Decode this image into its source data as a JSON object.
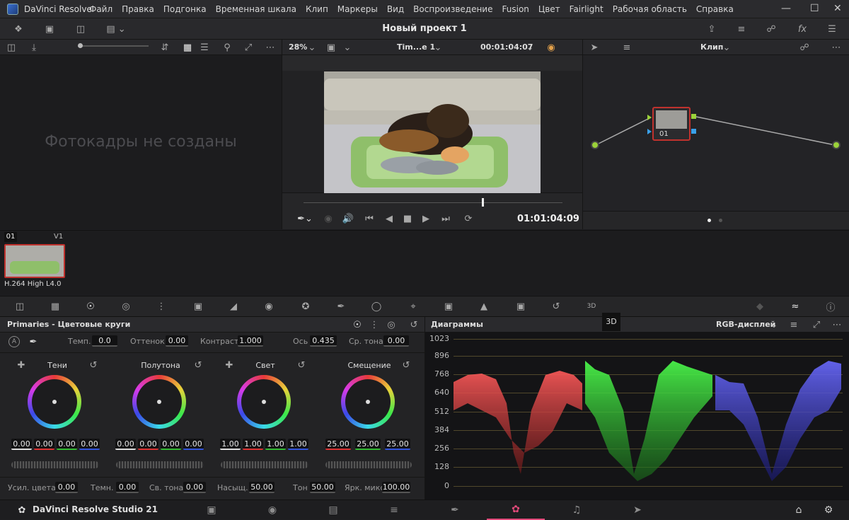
{
  "titlebar": {
    "app": "DaVinci Resolve",
    "menu": [
      "Файл",
      "Правка",
      "Подгонка",
      "Временная шкала",
      "Клип",
      "Маркеры",
      "Вид",
      "Воспроизведение",
      "Fusion",
      "Цвет",
      "Fairlight",
      "Рабочая область",
      "Справка"
    ]
  },
  "toolbar": {
    "project_title": "Новый проект 1"
  },
  "viewer": {
    "zoom": "28%",
    "timeline_name": "Tim...e 1",
    "timecode_top": "00:01:04:07",
    "timecode": "01:01:04:09"
  },
  "nodes": {
    "mode": "Клип",
    "node_label": "01"
  },
  "gallery": {
    "empty_text": "Фотокадры не созданы"
  },
  "clips": {
    "clip_number": "01",
    "track": "V1",
    "codec": "H.264 High L4.0"
  },
  "primaries": {
    "title": "Primaries - Цветовые круги",
    "temp_label": "Темп.",
    "temp": "0.0",
    "tint_label": "Оттенок",
    "tint": "0.00",
    "contrast_label": "Контраст",
    "contrast": "1.000",
    "pivot_label": "Ось",
    "pivot": "0.435",
    "midtone_label": "Ср. тона",
    "midtone": "0.00",
    "wheels": [
      {
        "name": "Тени",
        "vals": [
          "0.00",
          "0.00",
          "0.00",
          "0.00"
        ]
      },
      {
        "name": "Полутона",
        "vals": [
          "0.00",
          "0.00",
          "0.00",
          "0.00"
        ]
      },
      {
        "name": "Свет",
        "vals": [
          "1.00",
          "1.00",
          "1.00",
          "1.00"
        ]
      },
      {
        "name": "Смещение",
        "vals": [
          "25.00",
          "25.00",
          "25.00"
        ]
      }
    ],
    "bottom": {
      "color_boost_label": "Усил. цвета",
      "color_boost": "0.00",
      "shadows_label": "Темн.",
      "shadows": "0.00",
      "highlights_label": "Св. тона",
      "highlights": "0.00",
      "sat_label": "Насыщ.",
      "sat": "50.00",
      "hue_label": "Тон",
      "hue": "50.00",
      "lum_mix_label": "Ярк. микс",
      "lum_mix": "100.00"
    }
  },
  "scopes": {
    "title": "Диаграммы",
    "mode": "RGB-дисплей",
    "badge": "3D",
    "scale": [
      "1023",
      "896",
      "768",
      "640",
      "512",
      "384",
      "256",
      "128",
      "0"
    ]
  },
  "bottombar": {
    "product": "DaVinci Resolve Studio 21"
  },
  "icons": [
    "logo-icon",
    "settings-icon",
    "home-icon"
  ]
}
